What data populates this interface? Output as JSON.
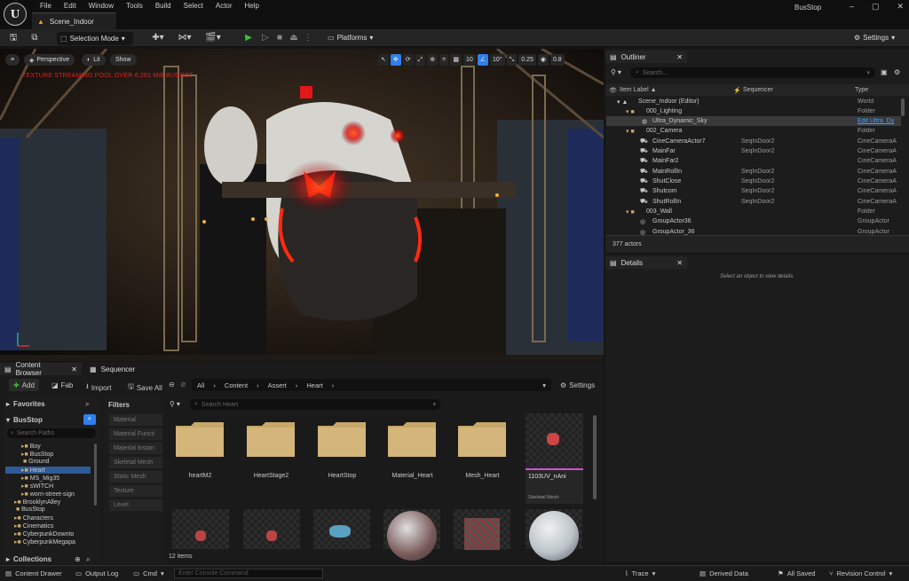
{
  "app": {
    "logo": "U",
    "menu": [
      "File",
      "Edit",
      "Window",
      "Tools",
      "Build",
      "Select",
      "Actor",
      "Help"
    ],
    "document_tab": "Scene_Indoor",
    "project_name": "BusStop",
    "window_controls": [
      "–",
      "▢",
      "✕"
    ]
  },
  "toolbar": {
    "selection_mode": "Selection Mode",
    "platforms": "Platforms",
    "settings": "Settings"
  },
  "viewport": {
    "perspective": "Perspective",
    "lit": "Lit",
    "show": "Show",
    "grid_size": "10",
    "rotation_snap": "10°",
    "scale_snap": "0.25",
    "camera_speed": "0.8",
    "warning": "TEXTURE STREAMING POOL OVER 6.281 MiB BUDGET"
  },
  "outliner": {
    "tab": "Outliner",
    "search_placeholder": "Search...",
    "columns": [
      "Item Label ▲",
      "Sequencer",
      "Type"
    ],
    "rows": [
      {
        "label": "Scene_Indoor (Editor)",
        "sequencer": "",
        "type": "World"
      },
      {
        "label": "000_Lighting",
        "sequencer": "",
        "type": "Folder"
      },
      {
        "label": "Ultra_Dynamic_Sky",
        "sequencer": "",
        "type": "Edit Ultra_Dy"
      },
      {
        "label": "002_Camera",
        "sequencer": "",
        "type": "Folder"
      },
      {
        "label": "CineCameraActor7",
        "sequencer": "SeqInDoor2",
        "type": "CineCameraA"
      },
      {
        "label": "MainFar",
        "sequencer": "SeqInDoor2",
        "type": "CineCameraA"
      },
      {
        "label": "MainFar2",
        "sequencer": "",
        "type": "CineCameraA"
      },
      {
        "label": "MainRollIn",
        "sequencer": "SeqInDoor2",
        "type": "CineCameraA"
      },
      {
        "label": "ShutClose",
        "sequencer": "SeqInDoor2",
        "type": "CineCameraA"
      },
      {
        "label": "Shutcom",
        "sequencer": "SeqInDoor2",
        "type": "CineCameraA"
      },
      {
        "label": "ShutRollIn",
        "sequencer": "SeqInDoor2",
        "type": "CineCameraA"
      },
      {
        "label": "003_Wall",
        "sequencer": "",
        "type": "Folder"
      },
      {
        "label": "GroupActor36",
        "sequencer": "",
        "type": "GroupActor"
      },
      {
        "label": "GroupActor_36",
        "sequencer": "",
        "type": "GroupActor"
      }
    ],
    "actor_count": "377 actors"
  },
  "details": {
    "tab": "Details",
    "empty_message": "Select an object to view details."
  },
  "content_browser": {
    "tab": "Content Browser",
    "tab2": "Sequencer",
    "add": "Add",
    "fab": "Fab",
    "import": "Import",
    "save_all": "Save All",
    "path": [
      "All",
      "Content",
      "Assert",
      "Heart"
    ],
    "settings": "Settings",
    "favorites": "Favorites",
    "project": "BusStop",
    "search_paths_placeholder": "Search Paths",
    "tree": [
      "Boy",
      "BusStop",
      "Ground",
      "Heart",
      "MS_Mig35",
      "sWITCH",
      "worn-street-sign",
      "BrooklynAlley",
      "BusStop",
      "Characters",
      "Cinematics",
      "CyberpunkDownto",
      "CyberpunkMegapa"
    ],
    "collections": "Collections",
    "filters_title": "Filters",
    "filters": [
      "Material",
      "Material Functi",
      "Material Instan",
      "Skeletal Mesh",
      "Static Mesh",
      "Texture",
      "Level"
    ],
    "search_placeholder": "Search Heart",
    "assets": [
      {
        "name": "heartM2"
      },
      {
        "name": "HeartStage2"
      },
      {
        "name": "HeartStop"
      },
      {
        "name": "Material_Heart"
      },
      {
        "name": "Mesh_Heart"
      },
      {
        "name": "1103UV_nAni",
        "subtype": "Skeletal Mesh"
      }
    ],
    "item_count": "12 items"
  },
  "statusbar": {
    "content_drawer": "Content Drawer",
    "output_log": "Output Log",
    "cmd": "Cmd",
    "console_placeholder": "Enter Console Command",
    "trace": "Trace",
    "derived_data": "Derived Data",
    "all_saved": "All Saved",
    "revision_control": "Revision Control"
  },
  "colors": {
    "accent": "#2f80ed",
    "warning": "#e02020",
    "folder": "#c8a86a"
  }
}
